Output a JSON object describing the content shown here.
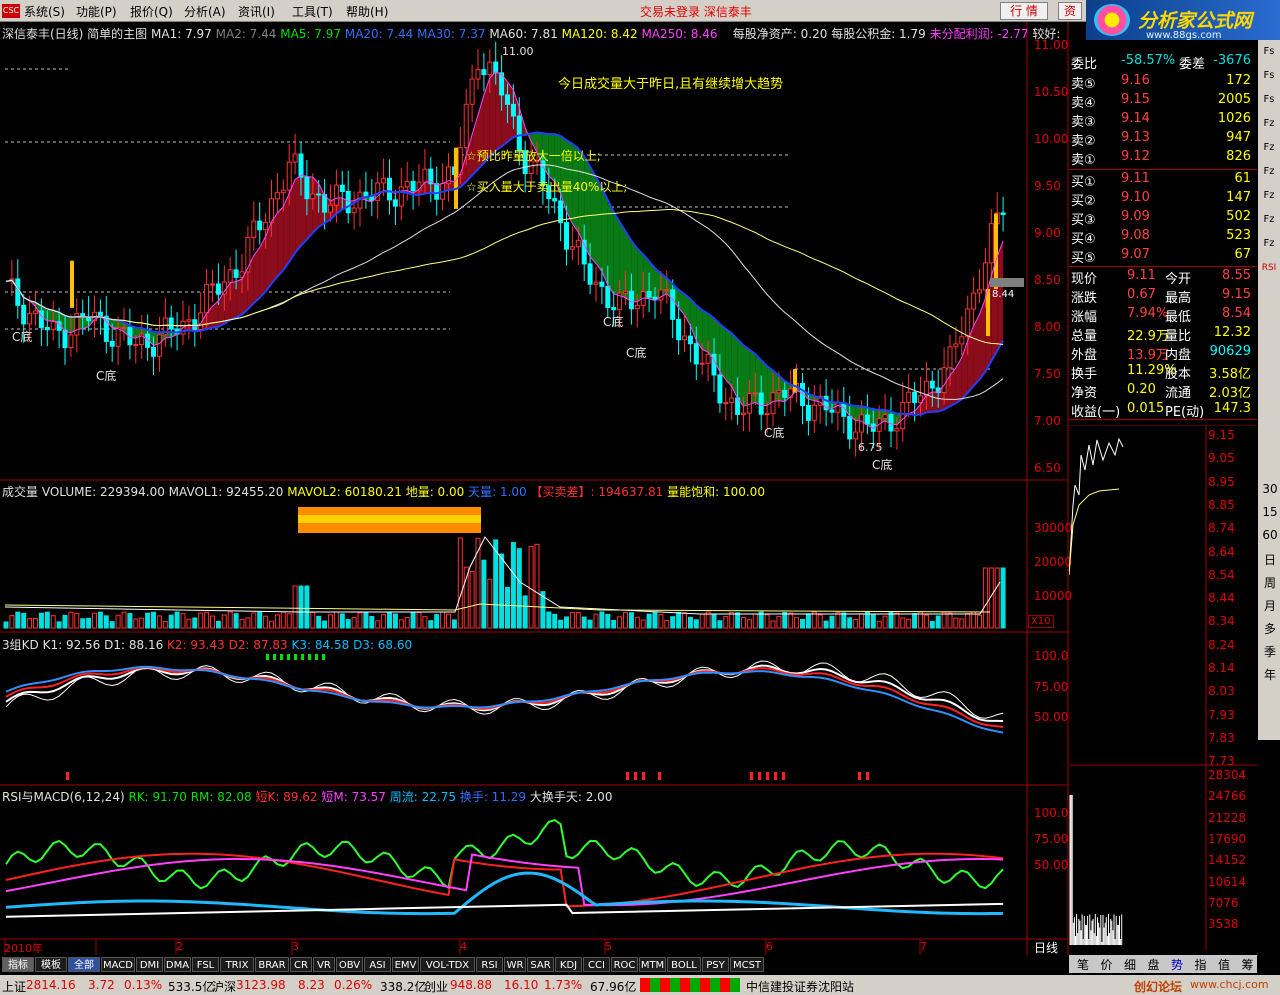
{
  "menubar": {
    "items": [
      "系统(S)",
      "功能(P)",
      "报价(Q)",
      "分析(A)",
      "资讯(I)",
      "工具(T)",
      "帮助(H)"
    ],
    "status": "交易未登录  深信泰丰",
    "btn_market": "行 情",
    "btn_trade": "资",
    "logo": "CSC",
    "brand": "分析家公式网",
    "brand_url": "www.88gs.com"
  },
  "main_panel": {
    "title": "深信泰丰(日线) 简单的主图",
    "ma1": "MA1: 7.97",
    "ma2": "MA2: 7.44",
    "ma5": "MA5: 7.97",
    "ma20": "MA20: 7.44",
    "ma30": "MA30: 7.37",
    "ma60": "MA60: 7.81",
    "ma120": "MA120: 8.42",
    "ma250": "MA250: 8.46",
    "bvps": "每股净资产: 0.20",
    "reserve": "每股公积金: 1.79",
    "undist": "未分配利润: -2.77",
    "better": "较好:",
    "note1": "今日成交量大于昨日,且有继续增大趋势",
    "note2": "☆预比昨量放大一倍以上;",
    "note3": "☆买入量大于卖出量40%以上;",
    "high_mark": "11.00",
    "low_mark": "6.75",
    "price_tag": "8.44",
    "c_labels": [
      "C底",
      "C底",
      "C底",
      "C底",
      "C底",
      "C底"
    ]
  },
  "price_axis": [
    "11.00",
    "10.50",
    "10.00",
    "9.50",
    "9.00",
    "8.50",
    "8.00",
    "7.50",
    "7.00",
    "6.50"
  ],
  "volume_panel": {
    "title": "成交量",
    "volume": "VOLUME: 229394.00",
    "mavol1": "MAVOL1: 92455.20",
    "mavol2": "MAVOL2: 60180.21",
    "diliang": "地量: 0.00",
    "tianliang": "天量: 1.00",
    "buysell": "【买卖差】: 194637.81",
    "sat": "量能饱和: 100.00",
    "axis": [
      "30000",
      "20000",
      "10000"
    ],
    "unit": "X10"
  },
  "kd_panel": {
    "title": "3组KD",
    "k1": "K1: 92.56",
    "d1": "D1: 88.16",
    "k2": "K2: 93.43",
    "d2": "D2: 87.83",
    "k3": "K3: 84.58",
    "d3": "D3: 68.60",
    "axis": [
      "100.0",
      "75.00",
      "50.00"
    ]
  },
  "rsi_panel": {
    "title": "RSI与MACD(6,12,24)",
    "rk": "RK: 91.70",
    "rm": "RM: 82.08",
    "dk": "短K: 89.62",
    "dm": "短M: 73.57",
    "zl": "周流: 22.75",
    "hs": "换手: 11.29",
    "dhs": "大换手天: 2.00",
    "axis": [
      "100.0",
      "75.00",
      "50.00"
    ]
  },
  "date_axis": {
    "year": "2010年",
    "months": [
      "2",
      "3",
      "4",
      "5",
      "6",
      "7"
    ]
  },
  "quote": {
    "weibi_label": "委比",
    "weibi": "-58.57%",
    "weicha_label": "委差",
    "weicha": "-3676",
    "asks": [
      {
        "label": "卖⑤",
        "price": "9.16",
        "vol": "172"
      },
      {
        "label": "卖④",
        "price": "9.15",
        "vol": "2005"
      },
      {
        "label": "卖③",
        "price": "9.14",
        "vol": "1026"
      },
      {
        "label": "卖②",
        "price": "9.13",
        "vol": "947"
      },
      {
        "label": "卖①",
        "price": "9.12",
        "vol": "826"
      }
    ],
    "bids": [
      {
        "label": "买①",
        "price": "9.11",
        "vol": "61"
      },
      {
        "label": "买②",
        "price": "9.10",
        "vol": "147"
      },
      {
        "label": "买③",
        "price": "9.09",
        "vol": "502"
      },
      {
        "label": "买④",
        "price": "9.08",
        "vol": "523"
      },
      {
        "label": "买⑤",
        "price": "9.07",
        "vol": "67"
      }
    ],
    "stats": [
      {
        "l1": "现价",
        "v1": "9.11",
        "l2": "今开",
        "v2": "8.55"
      },
      {
        "l1": "涨跌",
        "v1": "0.67",
        "l2": "最高",
        "v2": "9.15"
      },
      {
        "l1": "涨幅",
        "v1": "7.94%",
        "l2": "最低",
        "v2": "8.54"
      },
      {
        "l1": "总量",
        "v1": "22.9万",
        "l2": "量比",
        "v2": "12.32"
      },
      {
        "l1": "外盘",
        "v1": "13.9万",
        "l2": "内盘",
        "v2": "90629"
      },
      {
        "l1": "换手",
        "v1": "11.29%",
        "l2": "股本",
        "v2": "3.58亿"
      },
      {
        "l1": "净资",
        "v1": "0.20",
        "l2": "流通",
        "v2": "2.03亿"
      },
      {
        "l1": "收益(一)",
        "v1": "0.015",
        "l2": "PE(动)",
        "v2": "147.3"
      }
    ]
  },
  "intraday_axis": [
    "9.15",
    "9.05",
    "8.95",
    "8.85",
    "8.74",
    "8.64",
    "8.54",
    "8.44",
    "8.34",
    "8.24",
    "8.14",
    "8.03",
    "7.93",
    "7.83",
    "7.73"
  ],
  "intraday_vol_axis": [
    "28304",
    "24766",
    "21228",
    "17690",
    "14152",
    "10614",
    "7076",
    "3538"
  ],
  "side_labels": [
    "30",
    "15",
    "60",
    "日",
    "周",
    "月",
    "多",
    "季",
    "年"
  ],
  "side_label_daily": "日线",
  "right_tools": [
    "Fs",
    "Fs",
    "Fs",
    "Fz",
    "Fz",
    "Fz",
    "Fz",
    "Fz",
    "Fz",
    "RSI"
  ],
  "indicator_tabs": [
    "指标",
    "模板",
    "全部",
    "MACD",
    "DMI",
    "DMA",
    "FSL",
    "TRIX",
    "BRAR",
    "CR",
    "VR",
    "OBV",
    "ASI",
    "EMV",
    "VOL-TDX",
    "RSI",
    "WR",
    "SAR",
    "KDJ",
    "CCI",
    "ROC",
    "MTM",
    "BOLL",
    "PSY",
    "MCST"
  ],
  "right_tabs": [
    "笔",
    "价",
    "细",
    "盘",
    "势",
    "指",
    "值",
    "筹"
  ],
  "statusbar": {
    "sh_label": "上证",
    "sh_idx": "2814.16",
    "sh_chg": "3.72",
    "sh_pct": "0.13%",
    "sh_amt": "533.5亿",
    "hs_label": "沪深",
    "hs_idx": "3123.98",
    "hs_chg": "8.23",
    "hs_pct": "0.26%",
    "hs_amt": "338.2亿",
    "cy_label": "创业",
    "cy_idx": "948.88",
    "cy_chg": "16.10",
    "cy_pct": "1.73%",
    "cy_amt": "67.96亿",
    "broker": "中信建投证券沈阳站",
    "forum": "创幻论坛",
    "forum_url": "www.chcj.com"
  },
  "colors": {
    "up": "#ff3030",
    "down": "#00ffff",
    "grid": "#a00000"
  }
}
